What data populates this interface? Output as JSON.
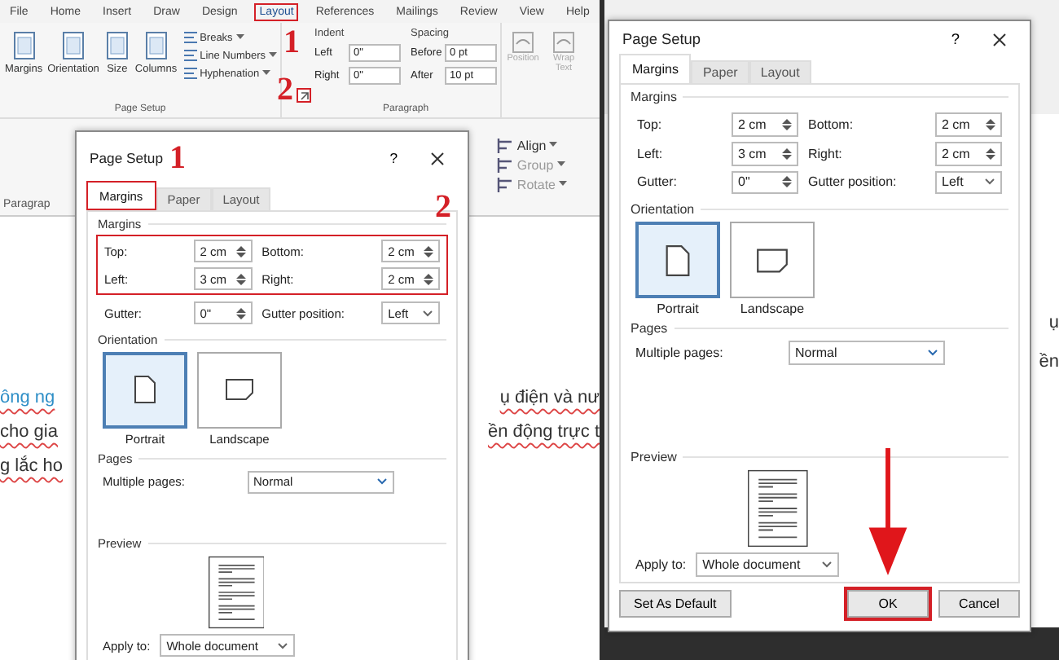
{
  "ribbon": {
    "tabs": [
      {
        "label": "File",
        "selected": false,
        "highlighted": false
      },
      {
        "label": "Home",
        "selected": false,
        "highlighted": false
      },
      {
        "label": "Insert",
        "selected": false,
        "highlighted": false
      },
      {
        "label": "Draw",
        "selected": false,
        "highlighted": false
      },
      {
        "label": "Design",
        "selected": false,
        "highlighted": false
      },
      {
        "label": "Layout",
        "selected": true,
        "highlighted": true
      },
      {
        "label": "References",
        "selected": false,
        "highlighted": false
      },
      {
        "label": "Mailings",
        "selected": false,
        "highlighted": false
      },
      {
        "label": "Review",
        "selected": false,
        "highlighted": false
      },
      {
        "label": "View",
        "selected": false,
        "highlighted": false
      },
      {
        "label": "Help",
        "selected": false,
        "highlighted": false
      }
    ],
    "tab_step": "1",
    "launcher_step": "2",
    "page_setup": {
      "big_buttons": [
        {
          "label": "Margins"
        },
        {
          "label": "Orientation"
        },
        {
          "label": "Size"
        },
        {
          "label": "Columns"
        }
      ],
      "menus": [
        {
          "label": "Breaks"
        },
        {
          "label": "Line Numbers"
        },
        {
          "label": "Hyphenation"
        }
      ],
      "group_label": "Page Setup"
    },
    "paragraph": {
      "indent_heading": "Indent",
      "spacing_heading": "Spacing",
      "indent": [
        {
          "label": "Left",
          "value": "0\""
        },
        {
          "label": "Right",
          "value": "0\""
        }
      ],
      "spacing": [
        {
          "label": "Before",
          "value": "0 pt"
        },
        {
          "label": "After",
          "value": "10 pt"
        }
      ],
      "group_label": "Paragraph"
    },
    "arrange": [
      {
        "label": "Position",
        "disabled": true
      },
      {
        "label": "Wrap Text",
        "disabled": true
      }
    ]
  },
  "ribbon_lower": {
    "group_label": "Paragrap",
    "arrange": [
      {
        "label": "Align",
        "disabled": false
      },
      {
        "label": "Group",
        "disabled": true
      },
      {
        "label": "Rotate",
        "disabled": true
      }
    ]
  },
  "document": {
    "lines": [
      {
        "left": {
          "text": "ông ng",
          "kind": "link"
        },
        "right": {
          "text": "ụ điện và nư",
          "kind": "plain"
        }
      },
      {
        "left": {
          "text": "cho gia",
          "kind": "plain"
        },
        "right": {
          "text": "ền động trực t",
          "kind": "plain"
        }
      },
      {
        "left": {
          "text": "g lắc ho",
          "kind": "plain"
        }
      }
    ]
  },
  "dialogs": [
    {
      "title": "Page Setup",
      "help": "?",
      "title_step": "1",
      "margins_step": "2",
      "margins_highlighted": true,
      "tabs": [
        {
          "label": "Margins",
          "selected": true,
          "highlighted": true
        },
        {
          "label": "Paper",
          "selected": false,
          "highlighted": false
        },
        {
          "label": "Layout",
          "selected": false,
          "highlighted": false
        }
      ],
      "margins_heading": "Margins",
      "fields": [
        {
          "label": "Top:",
          "value": "2 cm",
          "kind": "spin"
        },
        {
          "label": "Bottom:",
          "value": "2 cm",
          "kind": "spin"
        },
        {
          "label": "Left:",
          "value": "3 cm",
          "kind": "spin"
        },
        {
          "label": "Right:",
          "value": "2 cm",
          "kind": "spin"
        },
        {
          "label": "Gutter:",
          "value": "0\"",
          "kind": "spin"
        },
        {
          "label": "Gutter position:",
          "value": "Left",
          "kind": "dropdown"
        }
      ],
      "orientation_heading": "Orientation",
      "orientations": [
        {
          "label": "Portrait",
          "selected": true
        },
        {
          "label": "Landscape",
          "selected": false
        }
      ],
      "pages_heading": "Pages",
      "multiple_pages": {
        "label": "Multiple pages:",
        "value": "Normal"
      },
      "preview_heading": "Preview",
      "apply_to": {
        "label": "Apply to:",
        "value": "Whole document"
      }
    },
    {
      "title": "Page Setup",
      "help": "?",
      "margins_highlighted": false,
      "tabs": [
        {
          "label": "Margins",
          "selected": true,
          "highlighted": false
        },
        {
          "label": "Paper",
          "selected": false,
          "highlighted": false
        },
        {
          "label": "Layout",
          "selected": false,
          "highlighted": false
        }
      ],
      "margins_heading": "Margins",
      "fields": [
        {
          "label": "Top:",
          "value": "2 cm",
          "kind": "spin"
        },
        {
          "label": "Bottom:",
          "value": "2 cm",
          "kind": "spin"
        },
        {
          "label": "Left:",
          "value": "3 cm",
          "kind": "spin"
        },
        {
          "label": "Right:",
          "value": "2 cm",
          "kind": "spin"
        },
        {
          "label": "Gutter:",
          "value": "0\"",
          "kind": "spin"
        },
        {
          "label": "Gutter position:",
          "value": "Left",
          "kind": "dropdown"
        }
      ],
      "orientation_heading": "Orientation",
      "orientations": [
        {
          "label": "Portrait",
          "selected": true
        },
        {
          "label": "Landscape",
          "selected": false
        }
      ],
      "pages_heading": "Pages",
      "multiple_pages": {
        "label": "Multiple pages:",
        "value": "Normal"
      },
      "preview_heading": "Preview",
      "apply_to": {
        "label": "Apply to:",
        "value": "Whole document"
      },
      "buttons": [
        {
          "label": "Set As Default",
          "highlighted": false,
          "arrow": false
        },
        {
          "label": "OK",
          "highlighted": true,
          "arrow": true
        },
        {
          "label": "Cancel",
          "highlighted": false,
          "arrow": false
        }
      ]
    }
  ],
  "right_panel": {
    "document_fragments": [
      "ụ",
      "ền"
    ]
  }
}
